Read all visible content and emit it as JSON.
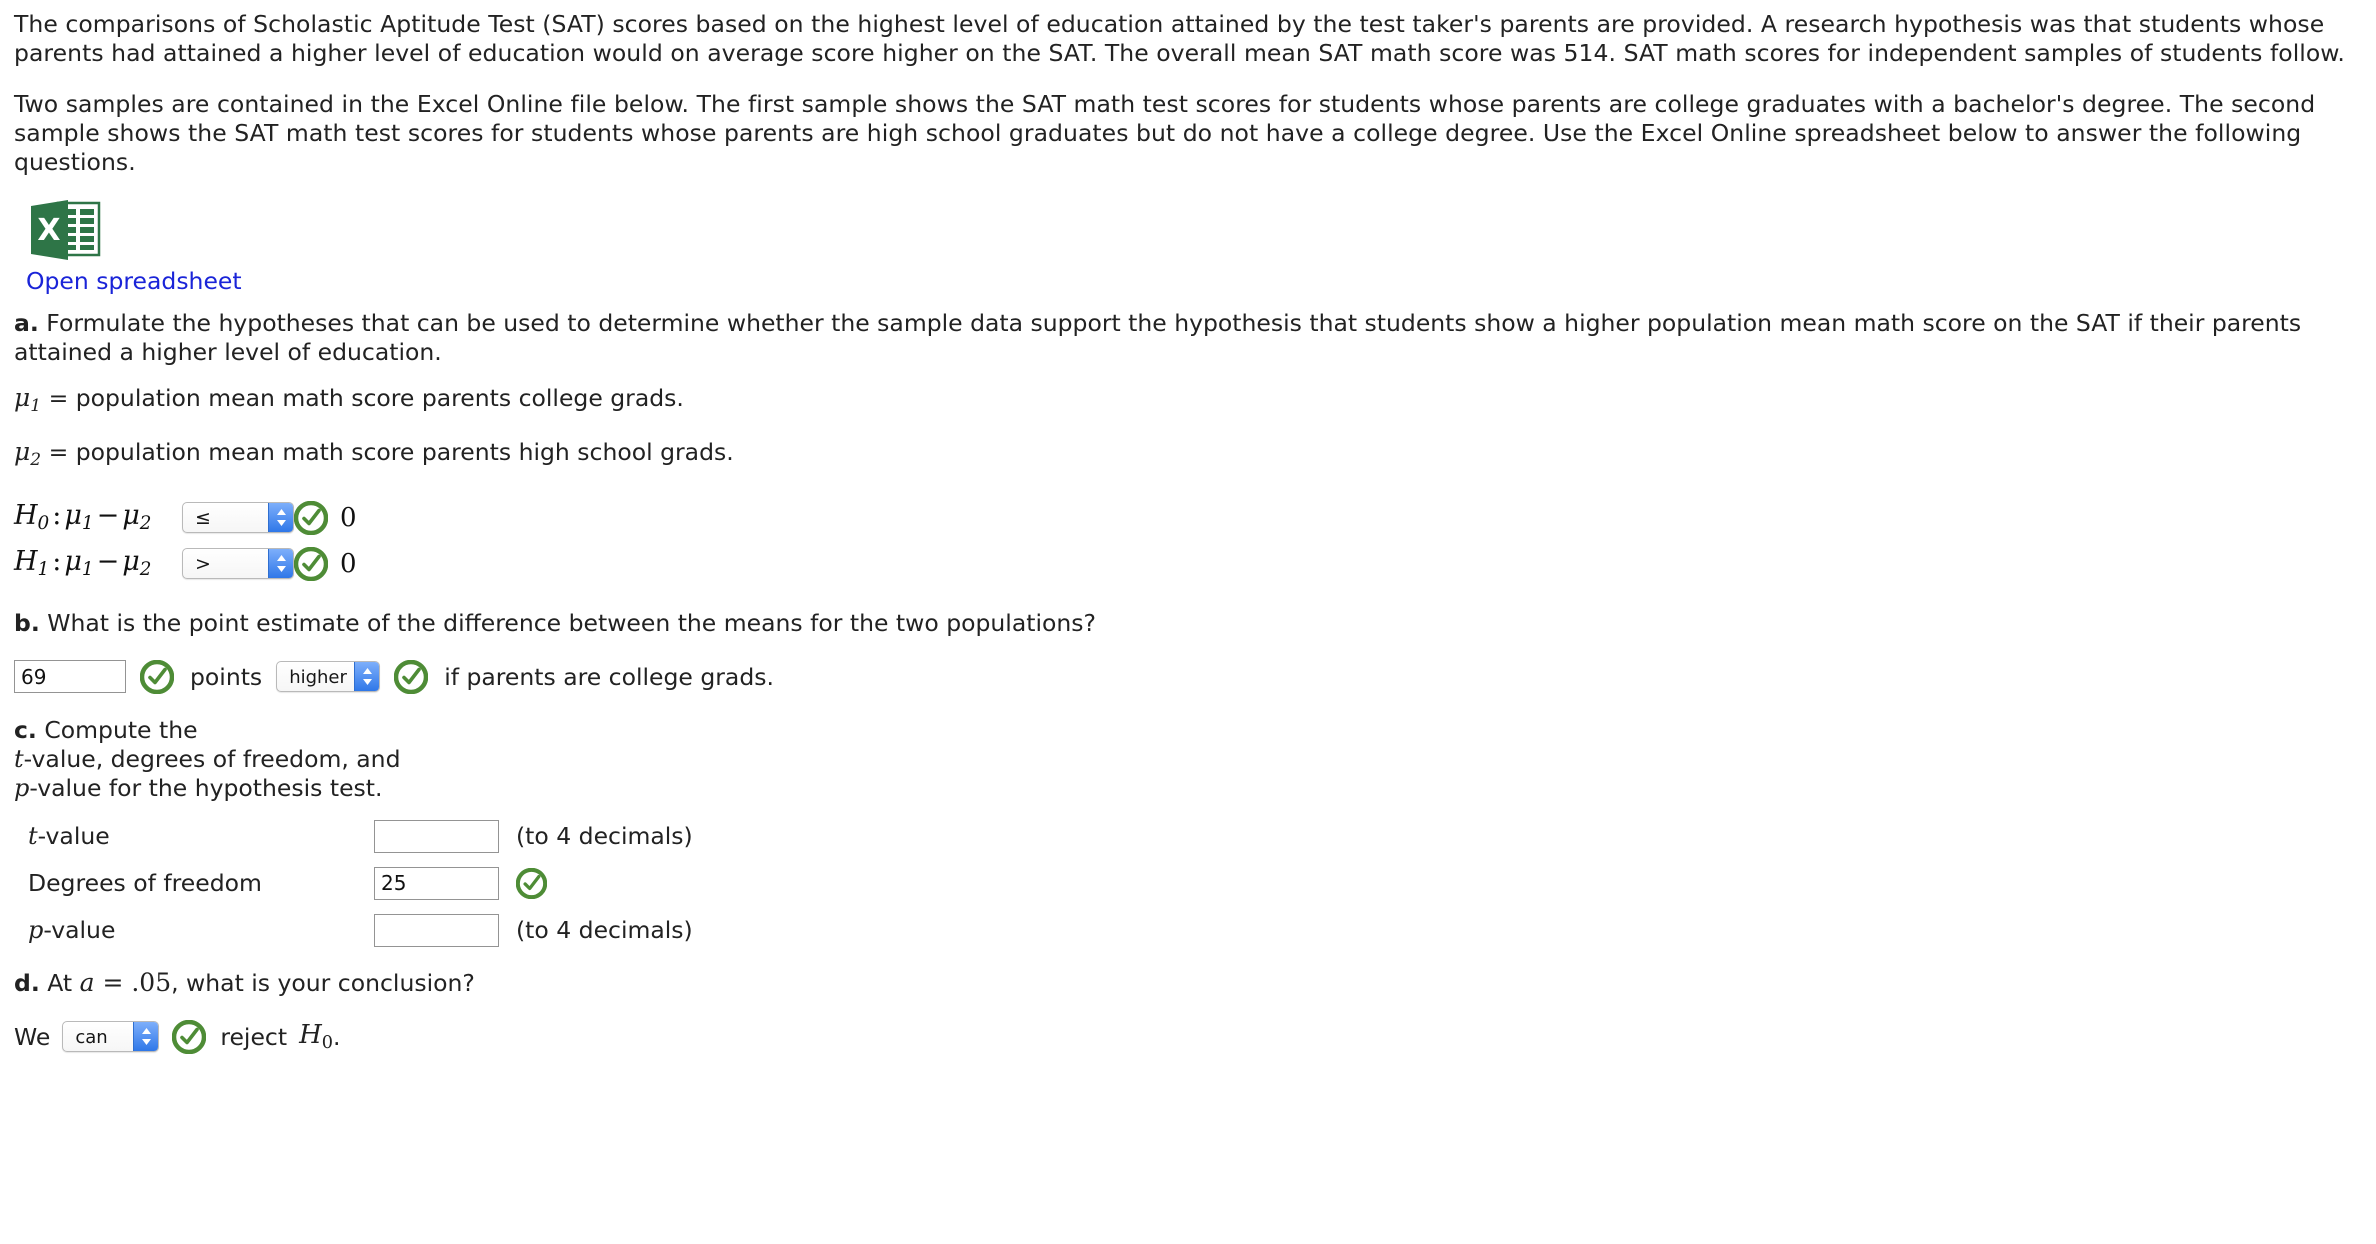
{
  "intro": {
    "paragraph1": "The comparisons of Scholastic Aptitude Test (SAT) scores based on the highest level of education attained by the test taker's parents are provided. A research hypothesis was that students whose parents had attained a higher level of education would on average score higher on the SAT. The overall mean SAT math score was 514. SAT math scores for independent samples of students follow.",
    "paragraph2": "Two samples are contained in the Excel Online file below. The first sample shows the SAT math test scores for students whose parents are college graduates with a bachelor's degree. The second sample shows the SAT math test scores for students whose parents are high school graduates but do not have a college degree. Use the Excel Online spreadsheet below to answer the following questions."
  },
  "spreadsheet": {
    "icon": "excel-icon",
    "icon_letter": "X",
    "link_label": "Open spreadsheet",
    "link_color": "#1a24d8",
    "icon_color": "#2e7547"
  },
  "part_a": {
    "marker": "a.",
    "prompt": "Formulate the hypotheses that can be used to determine whether the sample data support the hypothesis that students show a higher population mean math score on the SAT if their parents attained a higher level of education.",
    "mu1_line": "= population mean math score parents college grads.",
    "mu1_symbol": "μ",
    "mu1_sub": "1",
    "mu2_line": "= population mean math score parents high school grads.",
    "mu2_symbol": "μ",
    "mu2_sub": "2",
    "rows": [
      {
        "hyp_name": "H",
        "hyp_sub": "0",
        "expr_mu1": "μ",
        "expr_sub1": "1",
        "minus": "−",
        "expr_mu2": "μ",
        "expr_sub2": "2",
        "select_value": "≤",
        "status": "correct",
        "right_value": "0"
      },
      {
        "hyp_name": "H",
        "hyp_sub": "1",
        "expr_mu1": "μ",
        "expr_sub1": "1",
        "minus": "−",
        "expr_mu2": "μ",
        "expr_sub2": "2",
        "select_value": ">",
        "status": "correct",
        "right_value": "0"
      }
    ]
  },
  "part_b": {
    "marker": "b.",
    "prompt": "What is the point estimate of the difference between the means for the two populations?",
    "answer_value": "69",
    "answer_status": "correct",
    "points_label": "points",
    "direction_value": "higher",
    "direction_status": "correct",
    "trailing_text": "if parents are college grads."
  },
  "part_c": {
    "marker": "c.",
    "prompt_line1": "Compute the",
    "prompt_line2_math": "t",
    "prompt_line2_rest": "-value, degrees of freedom, and",
    "prompt_line3_math": "p",
    "prompt_line3_rest": "-value for the hypothesis test.",
    "rows": [
      {
        "label_math": "t",
        "label_rest": "-value",
        "value": "",
        "note": "(to 4 decimals)",
        "status": "none"
      },
      {
        "label_math": "",
        "label_rest": "Degrees of freedom",
        "value": "25",
        "note": "",
        "status": "correct"
      },
      {
        "label_math": "p",
        "label_rest": "-value",
        "value": "",
        "note": "(to 4 decimals)",
        "status": "none"
      }
    ]
  },
  "part_d": {
    "marker": "d.",
    "prompt_pre": "At ",
    "prompt_alpha": "a",
    "prompt_eq": " = ",
    "prompt_level": ".05",
    "prompt_post": ", what is your conclusion?",
    "we_label": "We",
    "select_value": "can",
    "status": "correct",
    "reject_label": "reject",
    "h_symbol": "H",
    "h_sub": "0",
    "period": "."
  },
  "colors": {
    "check_green": "#3f8a2e",
    "select_blue": "#2f77e8",
    "link_blue": "#1a24d8",
    "text": "#222222"
  }
}
